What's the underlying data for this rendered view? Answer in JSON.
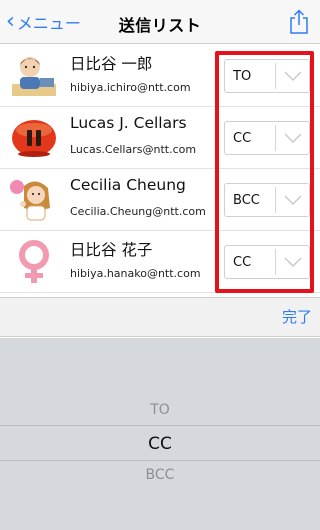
{
  "navbar": {
    "back_label": "メニュー",
    "title": "送信リスト",
    "back_icon": "chevron-left-icon",
    "share_icon": "share-icon"
  },
  "recipients": [
    {
      "name": "日比谷 一郎",
      "email": "hibiya.ichiro@ntt.com",
      "type": "TO",
      "avatar": "man-at-desk-avatar"
    },
    {
      "name": "Lucas J. Cellars",
      "email": "Lucas.Cellars@ntt.com",
      "type": "CC",
      "avatar": "red-pause-avatar"
    },
    {
      "name": "Cecilia Cheung",
      "email": "Cecilia.Cheung@ntt.com",
      "type": "BCC",
      "avatar": "woman-ok-avatar"
    },
    {
      "name": "日比谷 花子",
      "email": "hibiya.hanako@ntt.com",
      "type": "CC",
      "avatar": "female-symbol-avatar"
    }
  ],
  "toolbar": {
    "done_label": "完了"
  },
  "picker": {
    "options": [
      "TO",
      "CC",
      "BCC"
    ],
    "selected": "CC"
  },
  "colors": {
    "accent": "#2f7cf6",
    "highlight": "#e5121b",
    "picker_bg": "#d5d8dd"
  }
}
